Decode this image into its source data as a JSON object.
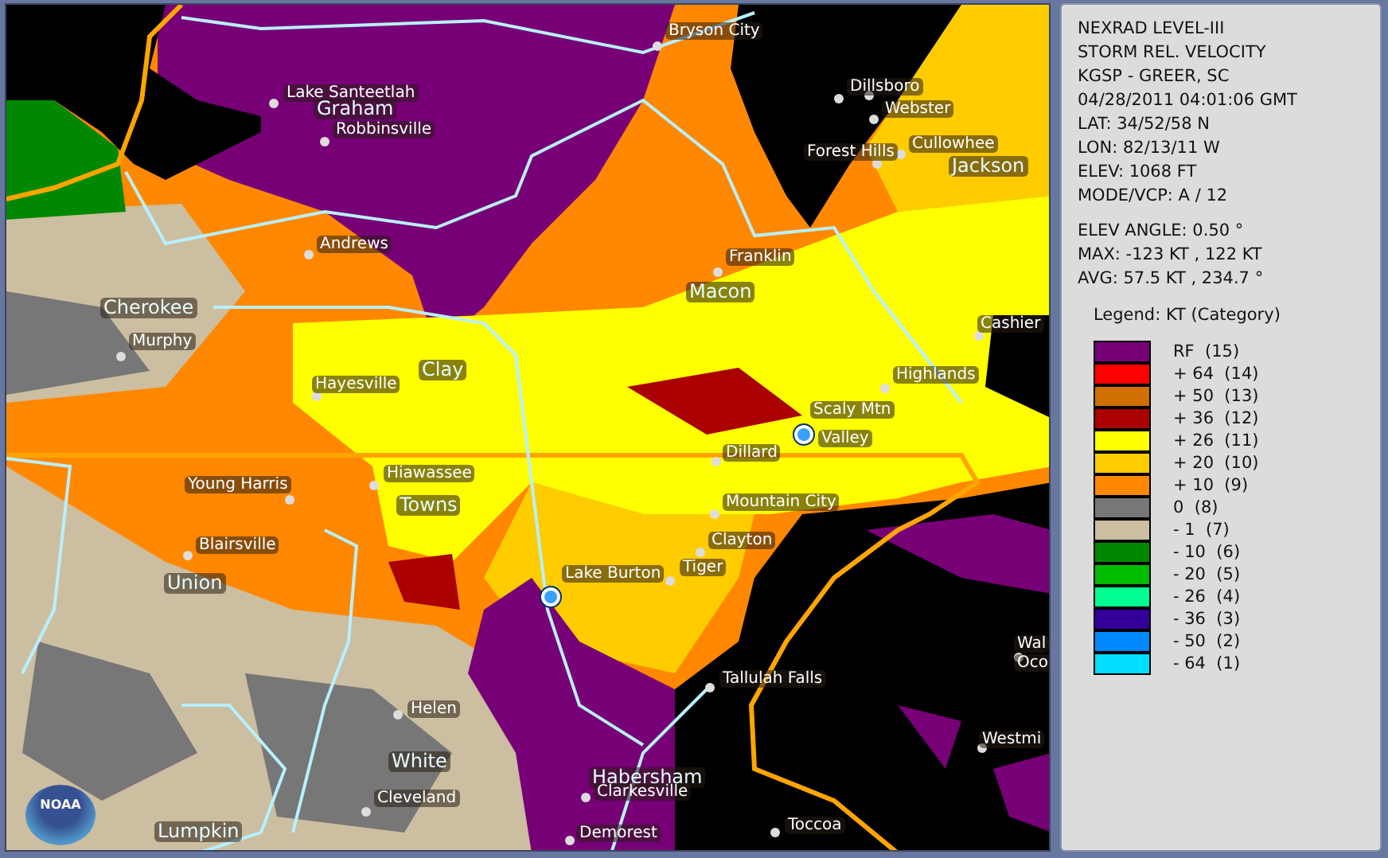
{
  "map": {
    "labels": [
      {
        "text": "Bryson City",
        "kind": "city"
      },
      {
        "text": "Lake Santeetlah",
        "kind": "city"
      },
      {
        "text": "Graham",
        "kind": "county"
      },
      {
        "text": "Robbinsville",
        "kind": "city"
      },
      {
        "text": "Dillsboro",
        "kind": "city"
      },
      {
        "text": "Webster",
        "kind": "city"
      },
      {
        "text": "Cullowhee",
        "kind": "city"
      },
      {
        "text": "Forest Hills",
        "kind": "city"
      },
      {
        "text": "Jackson",
        "kind": "county"
      },
      {
        "text": "Andrews",
        "kind": "city"
      },
      {
        "text": "Franklin",
        "kind": "city"
      },
      {
        "text": "Macon",
        "kind": "county"
      },
      {
        "text": "Cashier",
        "kind": "city"
      },
      {
        "text": "Cherokee",
        "kind": "county"
      },
      {
        "text": "Murphy",
        "kind": "city"
      },
      {
        "text": "Hayesville",
        "kind": "city"
      },
      {
        "text": "Clay",
        "kind": "county"
      },
      {
        "text": "Highlands",
        "kind": "city"
      },
      {
        "text": "Scaly Mtn",
        "kind": "city"
      },
      {
        "text": "Valley",
        "kind": "city"
      },
      {
        "text": "Dillard",
        "kind": "city"
      },
      {
        "text": "Hiawassee",
        "kind": "city"
      },
      {
        "text": "Towns",
        "kind": "county"
      },
      {
        "text": "Young Harris",
        "kind": "city"
      },
      {
        "text": "Mountain City",
        "kind": "city"
      },
      {
        "text": "Blairsville",
        "kind": "city"
      },
      {
        "text": "Clayton",
        "kind": "city"
      },
      {
        "text": "Union",
        "kind": "county"
      },
      {
        "text": "Lake Burton",
        "kind": "city"
      },
      {
        "text": "Tiger",
        "kind": "city"
      },
      {
        "text": "Tallulah Falls",
        "kind": "city"
      },
      {
        "text": "Wal",
        "kind": "city"
      },
      {
        "text": "Oco",
        "kind": "city"
      },
      {
        "text": "Helen",
        "kind": "city"
      },
      {
        "text": "Westmi",
        "kind": "city"
      },
      {
        "text": "White",
        "kind": "county"
      },
      {
        "text": "Habersham",
        "kind": "county"
      },
      {
        "text": "Clarkesville",
        "kind": "city"
      },
      {
        "text": "Cleveland",
        "kind": "city"
      },
      {
        "text": "Toccoa",
        "kind": "city"
      },
      {
        "text": "Lumpkin",
        "kind": "county"
      },
      {
        "text": "Demorest",
        "kind": "city"
      }
    ],
    "logo": "NOAA"
  },
  "info": {
    "header_lines": [
      "NEXRAD LEVEL-III",
      "STORM REL. VELOCITY",
      "KGSP - GREER, SC",
      "04/28/2011 04:01:06 GMT",
      "LAT: 34/52/58 N",
      "LON: 82/13/11 W",
      "ELEV: 1068 FT",
      "MODE/VCP: A / 12"
    ],
    "stats_lines": [
      "ELEV ANGLE: 0.50 °",
      "MAX: -123 KT , 122 KT",
      "AVG: 57.5 KT , 234.7 °"
    ]
  },
  "legend": {
    "title": "Legend: KT (Category)",
    "items": [
      {
        "label": "RF  (15)",
        "color": "#770077"
      },
      {
        "label": "+ 64  (14)",
        "color": "#ff0000"
      },
      {
        "label": "+ 50  (13)",
        "color": "#d07000"
      },
      {
        "label": "+ 36  (12)",
        "color": "#aa0000"
      },
      {
        "label": "+ 26  (11)",
        "color": "#ffff00"
      },
      {
        "label": "+ 20  (10)",
        "color": "#ffcc00"
      },
      {
        "label": "+ 10  (9)",
        "color": "#ff8800"
      },
      {
        "label": "0  (8)",
        "color": "#777777"
      },
      {
        "label": "- 1  (7)",
        "color": "#ccbea0"
      },
      {
        "label": "- 10  (6)",
        "color": "#008800"
      },
      {
        "label": "- 20  (5)",
        "color": "#00bb00"
      },
      {
        "label": "- 26  (4)",
        "color": "#00ff90"
      },
      {
        "label": "- 36  (3)",
        "color": "#330099"
      },
      {
        "label": "- 50  (2)",
        "color": "#0088ff"
      },
      {
        "label": "- 64  (1)",
        "color": "#00ddff"
      }
    ]
  }
}
